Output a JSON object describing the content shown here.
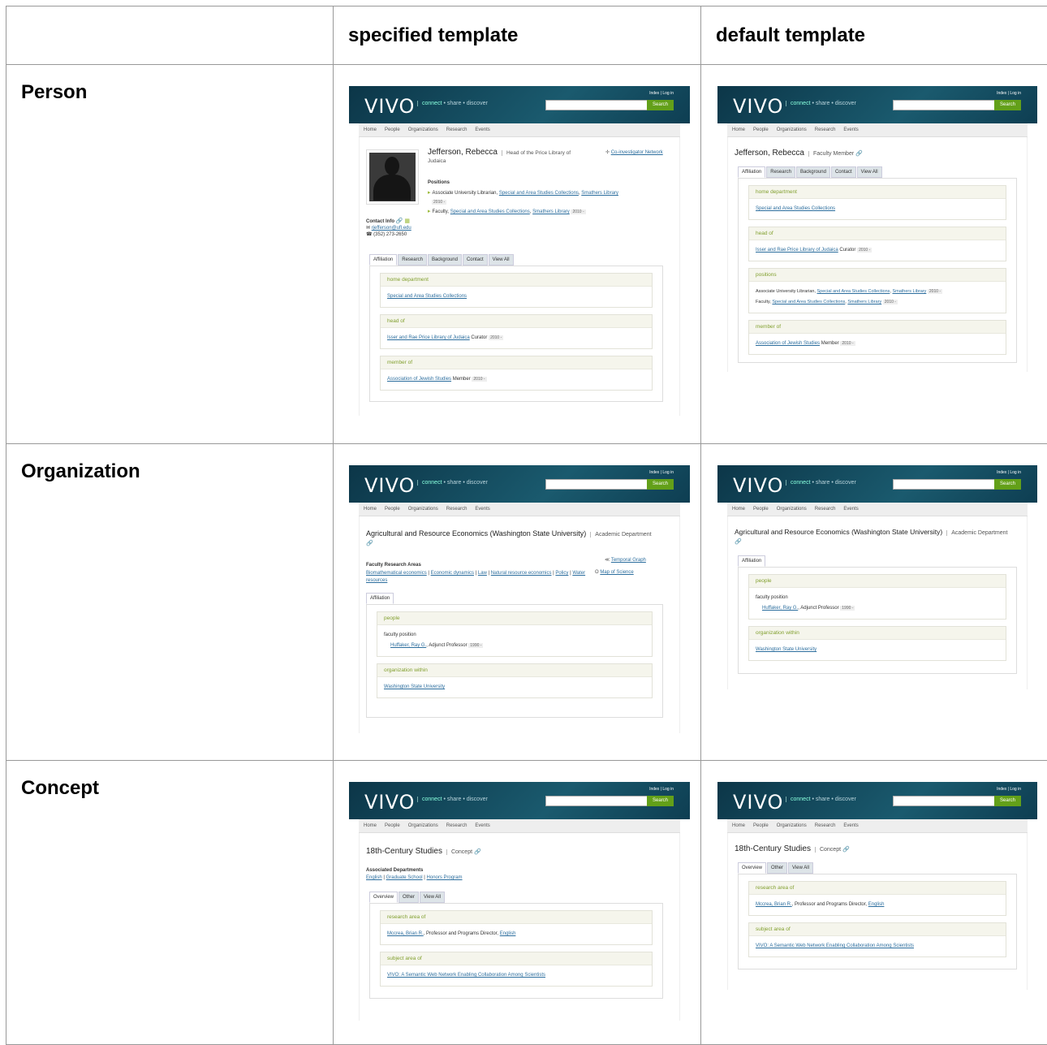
{
  "columns": {
    "blank": "",
    "specified": "specified template",
    "default": "default template"
  },
  "rows": {
    "person": "Person",
    "organization": "Organization",
    "concept": "Concept"
  },
  "vivo": {
    "logo": "VIVO",
    "tagline_1": "connect",
    "tagline_sep": " • ",
    "tagline_2": "share",
    "tagline_3": "discover",
    "index": "Index",
    "login": "Log in",
    "search_btn": "Search",
    "nav": [
      "Home",
      "People",
      "Organizations",
      "Research",
      "Events"
    ]
  },
  "person": {
    "name": "Jefferson, Rebecca",
    "type_specified": "Head of the Price Library of Judaica",
    "type_default": "Faculty Member",
    "positions_label": "Positions",
    "pos1_text": "Associate University Librarian, ",
    "pos1_link1": "Special and Area Studies Collections",
    "pos1_link2": "Smathers Library",
    "pos1_date": "2010 -",
    "pos2_text": "Faculty, ",
    "pos2_link1": "Special and Area Studies Collections",
    "pos2_link2": "Smathers Library",
    "pos2_date": "2010 -",
    "coinv": "Co-investigator Network",
    "contact_label": "Contact Info",
    "email": "rjefferson@ufl.edu",
    "phone": "(352) 273-2650",
    "tabs": [
      "Affiliation",
      "Research",
      "Background",
      "Contact",
      "View All"
    ],
    "g_home": "home department",
    "home_link": "Special and Area Studies Collections",
    "g_head": "head of",
    "head_link": "Isser and Rae Price Library of Judaica",
    "head_role": " Curator ",
    "head_date": "2010 -",
    "g_pos": "positions",
    "g_member": "member of",
    "member_link": "Association of Jewish Studies",
    "member_role": " Member ",
    "member_date": "2010 -"
  },
  "org": {
    "name": "Agricultural and Resource Economics (Washington State University)",
    "type": "Academic Department",
    "temporal": "Temporal Graph",
    "mapsci": "Map of Science",
    "fra_label": "Faculty Research Areas",
    "fra": [
      "Biomathematical economics",
      "Economic dynamics",
      "Law",
      "Natural resource economics",
      "Policy",
      "Water resources"
    ],
    "tab": "Affiliation",
    "g_people": "people",
    "fac_pos": "faculty position",
    "person_link": "Huffaker, Ray G.",
    "person_role": ", Adjunct Professor ",
    "person_date": "1990 -",
    "g_within": "organization within",
    "within_link": "Washington State University"
  },
  "concept": {
    "name": "18th-Century Studies",
    "type": "Concept",
    "assoc_label": "Associated Departments",
    "assoc": [
      "English",
      "Graduate School",
      "Honors Program"
    ],
    "tabs": [
      "Overview",
      "Other",
      "View All"
    ],
    "g_research": "research area of",
    "r_link": "Mccrea, Brian R.",
    "r_role": ", Professor and Programs Director, ",
    "r_link2": "English",
    "g_subject": "subject area of",
    "s_link": "VIVO: A Semantic Web Network Enabling Collaboration Among Scientists"
  }
}
